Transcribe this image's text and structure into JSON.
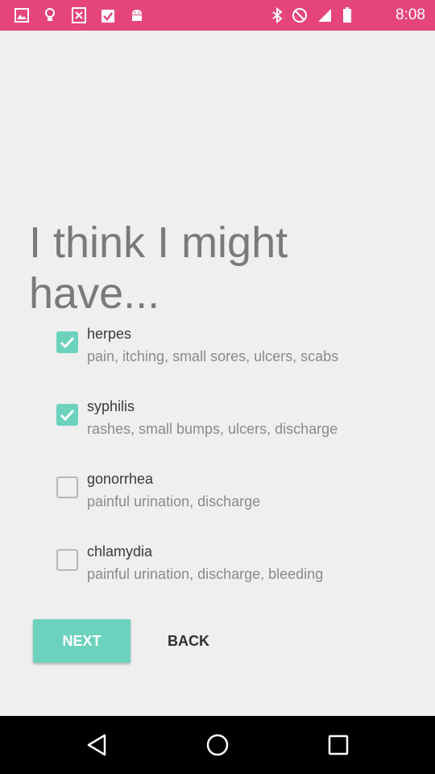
{
  "status_bar": {
    "time": "8:08",
    "color": "#e6457a",
    "left_icons": [
      "image-icon",
      "bulb-icon",
      "x-box-icon",
      "clipboard-check-icon",
      "android-icon"
    ],
    "right_icons": [
      "bluetooth-icon",
      "do-not-disturb-icon",
      "signal-icon",
      "battery-icon"
    ]
  },
  "main": {
    "heading": "I think I might have...",
    "options": [
      {
        "title": "herpes",
        "description": "pain, itching, small sores, ulcers, scabs",
        "checked": true
      },
      {
        "title": "syphilis",
        "description": "rashes, small bumps, ulcers, discharge",
        "checked": true
      },
      {
        "title": "gonorrhea",
        "description": "painful urination, discharge",
        "checked": false
      },
      {
        "title": "chlamydia",
        "description": "painful urination, discharge, bleeding",
        "checked": false
      }
    ],
    "next_label": "NEXT",
    "back_label": "BACK",
    "accent_color": "#6cd2bd"
  },
  "nav_bar": {
    "icons": [
      "back-triangle-icon",
      "home-circle-icon",
      "recents-square-icon"
    ]
  }
}
